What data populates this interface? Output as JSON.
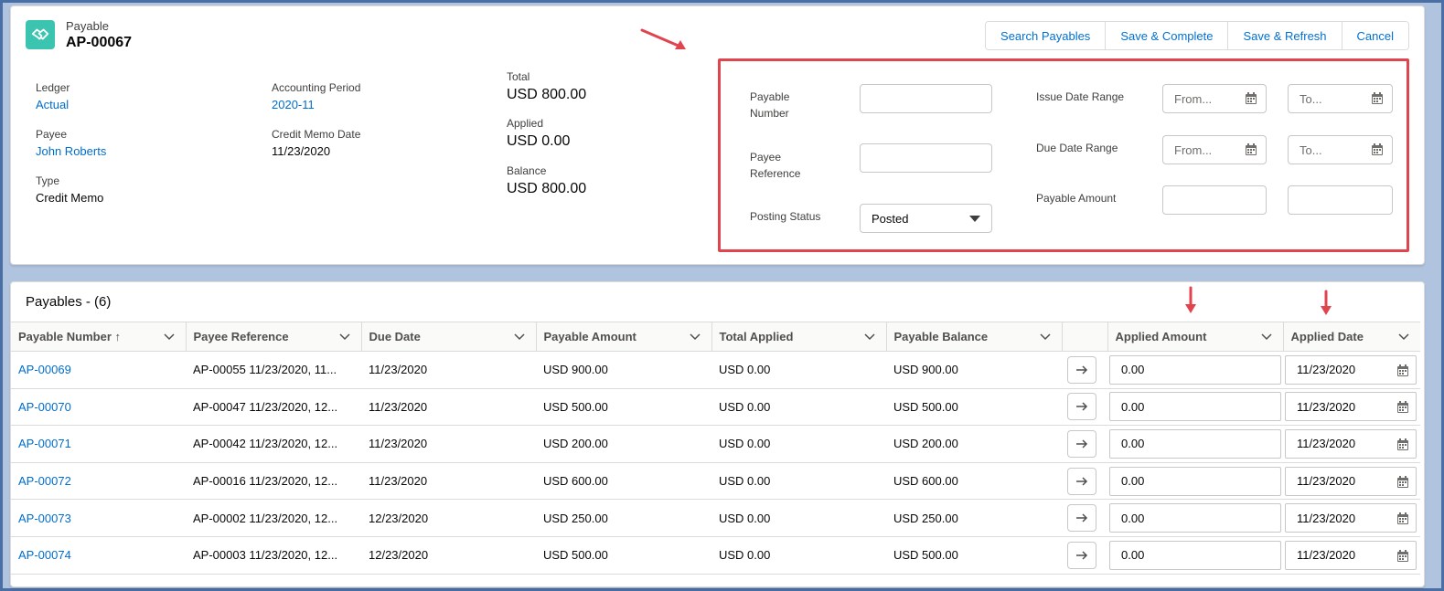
{
  "record": {
    "type_label": "Payable",
    "name": "AP-00067"
  },
  "actions": {
    "search": "Search Payables",
    "save_complete": "Save & Complete",
    "save_refresh": "Save & Refresh",
    "cancel": "Cancel"
  },
  "details": {
    "ledger_label": "Ledger",
    "ledger_value": "Actual",
    "payee_label": "Payee",
    "payee_value": "John Roberts",
    "type_label": "Type",
    "type_value": "Credit Memo",
    "period_label": "Accounting Period",
    "period_value": "2020-11",
    "memo_date_label": "Credit Memo Date",
    "memo_date_value": "11/23/2020",
    "total_label": "Total",
    "total_value": "USD 800.00",
    "applied_label": "Applied",
    "applied_value": "USD 0.00",
    "balance_label": "Balance",
    "balance_value": "USD 800.00"
  },
  "filters": {
    "payable_number_label": "Payable Number",
    "payee_reference_label": "Payee Reference",
    "posting_status_label": "Posting Status",
    "posting_status_value": "Posted",
    "issue_date_label": "Issue Date Range",
    "due_date_label": "Due Date Range",
    "payable_amount_label": "Payable Amount",
    "from_placeholder": "From...",
    "to_placeholder": "To..."
  },
  "table": {
    "title": "Payables - (6)",
    "columns": [
      "Payable Number ↑",
      "Payee Reference",
      "Due Date",
      "Payable Amount",
      "Total Applied",
      "Payable Balance",
      "",
      "Applied Amount",
      "Applied Date"
    ],
    "rows": [
      {
        "number": "AP-00069",
        "reference": "AP-00055 11/23/2020, 11...",
        "due": "11/23/2020",
        "amount": "USD 900.00",
        "applied": "USD 0.00",
        "balance": "USD 900.00",
        "applied_amount": "0.00",
        "applied_date": "11/23/2020"
      },
      {
        "number": "AP-00070",
        "reference": "AP-00047 11/23/2020, 12...",
        "due": "11/23/2020",
        "amount": "USD 500.00",
        "applied": "USD 0.00",
        "balance": "USD 500.00",
        "applied_amount": "0.00",
        "applied_date": "11/23/2020"
      },
      {
        "number": "AP-00071",
        "reference": "AP-00042 11/23/2020, 12...",
        "due": "11/23/2020",
        "amount": "USD 200.00",
        "applied": "USD 0.00",
        "balance": "USD 200.00",
        "applied_amount": "0.00",
        "applied_date": "11/23/2020"
      },
      {
        "number": "AP-00072",
        "reference": "AP-00016 11/23/2020, 12...",
        "due": "11/23/2020",
        "amount": "USD 600.00",
        "applied": "USD 0.00",
        "balance": "USD 600.00",
        "applied_amount": "0.00",
        "applied_date": "11/23/2020"
      },
      {
        "number": "AP-00073",
        "reference": "AP-00002 11/23/2020, 12...",
        "due": "12/23/2020",
        "amount": "USD 250.00",
        "applied": "USD 0.00",
        "balance": "USD 250.00",
        "applied_amount": "0.00",
        "applied_date": "11/23/2020"
      },
      {
        "number": "AP-00074",
        "reference": "AP-00003 11/23/2020, 12...",
        "due": "12/23/2020",
        "amount": "USD 500.00",
        "applied": "USD 0.00",
        "balance": "USD 500.00",
        "applied_amount": "0.00",
        "applied_date": "11/23/2020"
      }
    ]
  },
  "colors": {
    "accent": "#006dcc",
    "highlight": "#e0454f",
    "icon_bg": "#3bc4b0"
  },
  "icons": [
    "handshake-icon",
    "calendar-icon",
    "chevron-down-icon",
    "arrow-right-icon",
    "sort-up-icon"
  ]
}
